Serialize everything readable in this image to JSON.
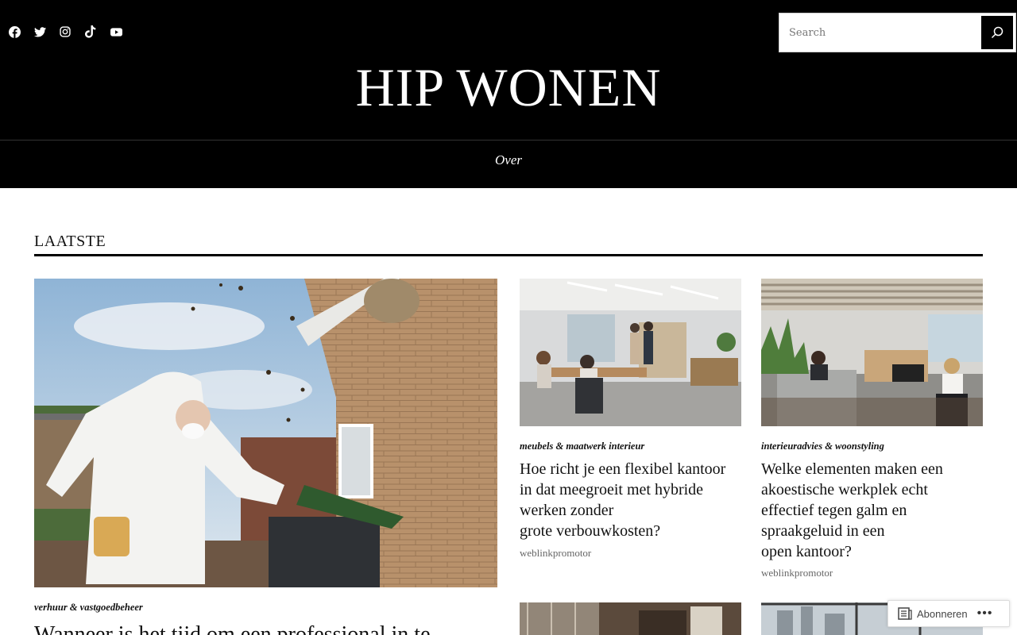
{
  "header": {
    "site_title": "HIP WONEN",
    "search": {
      "placeholder": "Search"
    },
    "social": [
      "facebook-icon",
      "twitter-icon",
      "instagram-icon",
      "tiktok-icon",
      "youtube-icon"
    ],
    "nav": [
      {
        "label": "Over"
      }
    ]
  },
  "section": {
    "title": "LAATSTE"
  },
  "posts": [
    {
      "category": "verhuur & vastgoedbeheer",
      "title": "Wanneer is het tijd om een professional in te",
      "image": "beekeeper-wasp-nest-photo"
    },
    {
      "category": "meubels & maatwerk interieur",
      "title_lines": [
        "Hoe richt je een flexibel kantoor",
        "in dat meegroeit met hybride",
        "werken zonder",
        "grote verbouwkosten?"
      ],
      "author": "weblinkpromotor",
      "image": "open-office-photo"
    },
    {
      "category": "interieuradvies & woonstyling",
      "title_lines": [
        "Welke elementen maken een",
        "akoestische werkplek echt",
        "effectief tegen galm en",
        "spraakgeluid in een",
        "open kantoor?"
      ],
      "author": "weblinkpromotor",
      "image": "acoustic-office-photo"
    },
    {
      "image": "cafe-interior-photo"
    },
    {
      "image": "city-view-office-photo"
    }
  ],
  "subscribe": {
    "label": "Abonneren",
    "more": "•••"
  },
  "colors": {
    "header_bg": "#000000",
    "text": "#111111",
    "meta": "#666666"
  }
}
